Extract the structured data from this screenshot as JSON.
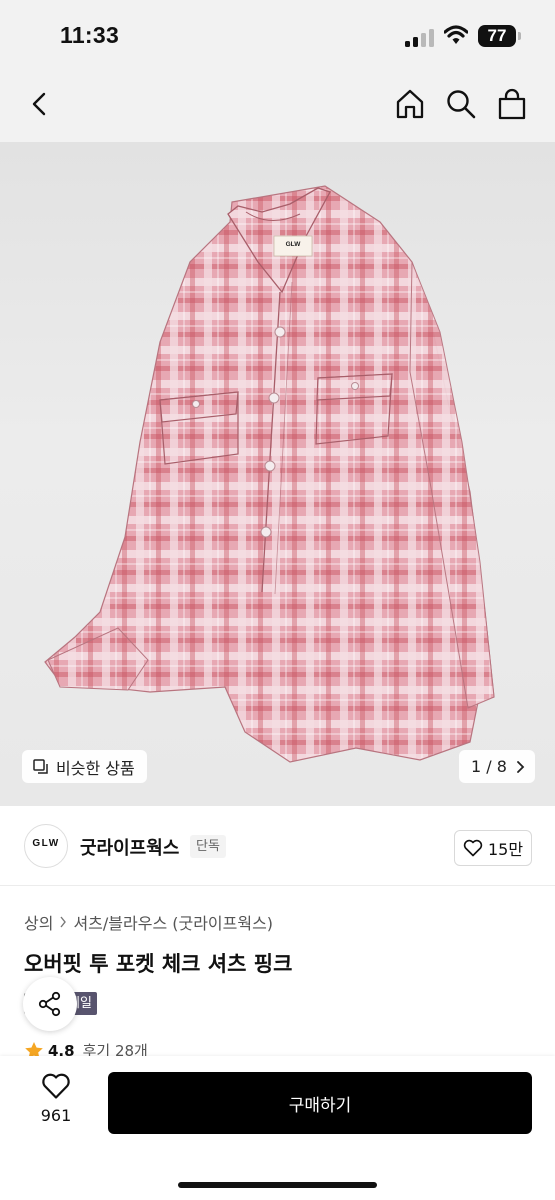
{
  "status_bar": {
    "time": "11:33",
    "battery": "77"
  },
  "colors": {
    "buy_button": "#000000",
    "sale_badge": "#58546e",
    "star": "#f5a623",
    "shirt": "#dc8f9c"
  },
  "nav": {
    "back_icon": "chevron-left-icon",
    "home_icon": "home-icon",
    "search_icon": "search-icon",
    "cart_icon": "shopping-bag-icon"
  },
  "gallery": {
    "similar_label": "비슷한 상품",
    "page_indicator": "1 / 8",
    "shirt_label_text": "GLW"
  },
  "brand": {
    "logo_text": "GLW",
    "name": "굿라이프웍스",
    "exclusive_badge": "단독",
    "likes": "15만"
  },
  "product": {
    "breadcrumb": [
      "상의",
      "셔츠/블라우스 (굿라이프웍스)"
    ],
    "title": "오버핏 투 포켓 체크 셔츠 핑크",
    "sale_badge": "세일",
    "rating": "4.8",
    "review_label": "후기 28개"
  },
  "bottom_bar": {
    "wish_count": "961",
    "buy_label": "구매하기"
  }
}
